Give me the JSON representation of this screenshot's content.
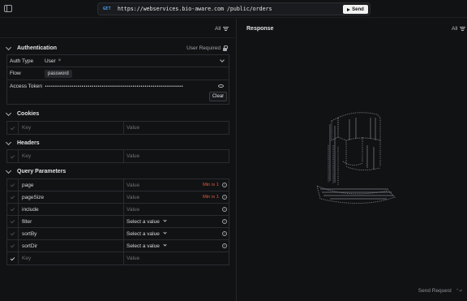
{
  "topbar": {
    "sidebar_toggle_icon": "sidebar-icon",
    "method": "GET",
    "url": "https://webservices.bio-aware.com /public/orders",
    "send_label": "Send",
    "send_icon": "play-icon"
  },
  "left_filter": {
    "label": "All",
    "icon": "filter-icon"
  },
  "authentication": {
    "title": "Authentication",
    "required_note": "User Required",
    "required_icon": "lock-icon",
    "auth_type_label": "Auth Type",
    "auth_type_value": "User",
    "flow_label": "Flow",
    "flow_value": "password",
    "token_label": "Access Token",
    "token_value": "••••••••••••••••••••••••••••••••••••••••••••••••••••••••••••••••••••",
    "clear_label": "Clear"
  },
  "cookies": {
    "title": "Cookies",
    "key_placeholder": "Key",
    "value_placeholder": "Value"
  },
  "headers": {
    "title": "Headers",
    "key_placeholder": "Key",
    "value_placeholder": "Value"
  },
  "query": {
    "title": "Query Parameters",
    "rows": [
      {
        "key": "page",
        "value": "Value",
        "note": "Min is 1"
      },
      {
        "key": "pageSize",
        "value": "Value",
        "note": "Min is 1"
      },
      {
        "key": "include",
        "value": "Value",
        "note": ""
      },
      {
        "key": "filter",
        "value": "Select a value",
        "note": ""
      },
      {
        "key": "sortBy",
        "value": "Select a value",
        "note": ""
      },
      {
        "key": "sortDir",
        "value": "Select a value",
        "note": ""
      }
    ],
    "empty_key": "Key",
    "empty_value": "Value"
  },
  "response": {
    "title": "Response",
    "filter_label": "All",
    "send_request_label": "Send Request",
    "shortcut": "⌃↵"
  },
  "colors": {
    "accent_get": "#4aa3ff",
    "warning": "#e05a3a",
    "background": "#111214"
  }
}
